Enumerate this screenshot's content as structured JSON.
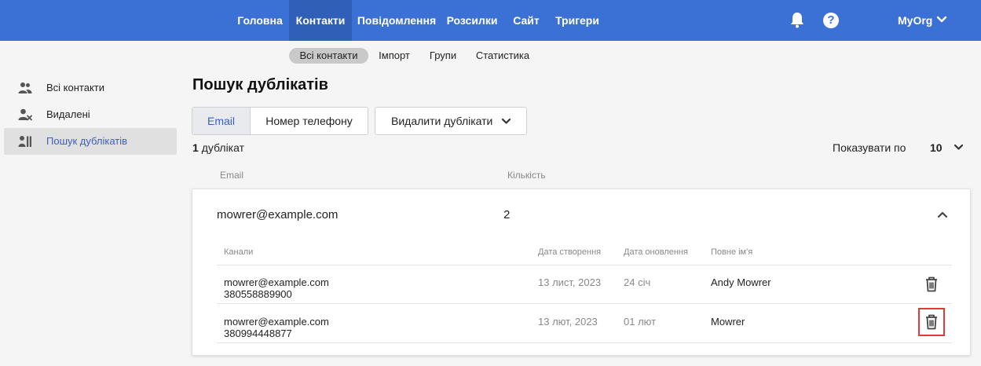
{
  "topnav": {
    "items": [
      {
        "label": "Головна",
        "active": false
      },
      {
        "label": "Контакти",
        "active": true
      },
      {
        "label": "Повідомлення",
        "active": false
      },
      {
        "label": "Розсилки",
        "active": false
      },
      {
        "label": "Сайт",
        "active": false
      },
      {
        "label": "Тригери",
        "active": false
      }
    ],
    "notifications_icon": "bell-icon",
    "help_icon": "help-icon",
    "help_glyph": "?",
    "org": "MyOrg",
    "org_icon": "chevron-down-icon"
  },
  "subnav": {
    "items": [
      {
        "label": "Всі контакти",
        "active": true
      },
      {
        "label": "Імпорт",
        "active": false
      },
      {
        "label": "Групи",
        "active": false
      },
      {
        "label": "Статистика",
        "active": false
      }
    ]
  },
  "sidebar": {
    "items": [
      {
        "label": "Всі контакти",
        "icon": "users-icon",
        "active": false
      },
      {
        "label": "Видалені",
        "icon": "user-remove-icon",
        "active": false
      },
      {
        "label": "Пошук дублікатів",
        "icon": "duplicates-icon",
        "active": true
      }
    ]
  },
  "main": {
    "title": "Пошук дублікатів",
    "filter": {
      "options": [
        "Email",
        "Номер телефону"
      ],
      "selected": "Email"
    },
    "delete_button": "Видалити дублікати",
    "count_value": "1",
    "count_label": "дублікат",
    "per_page_label": "Показувати по",
    "per_page_value": "10",
    "columns": {
      "email": "Email",
      "count": "Кількість"
    },
    "group": {
      "email": "mowrer@example.com",
      "count": "2",
      "expanded": true,
      "headers": {
        "channels": "Канали",
        "created": "Дата створення",
        "updated": "Дата оновлення",
        "name": "Повне ім'я"
      },
      "rows": [
        {
          "email": "mowrer@example.com",
          "phone": "380558889900",
          "created": "13 лист, 2023",
          "updated": "24 січ",
          "name": "Andy Mowrer",
          "highlighted": false
        },
        {
          "email": "mowrer@example.com",
          "phone": "380994448877",
          "created": "13 лют, 2023",
          "updated": "01 лют",
          "name": "Mowrer",
          "highlighted": true
        }
      ]
    }
  },
  "colors": {
    "header_bg": "#3b71d4",
    "header_active": "#2f5fb6",
    "accent_text": "#3b5fc0",
    "highlight": "#e03a3a"
  }
}
